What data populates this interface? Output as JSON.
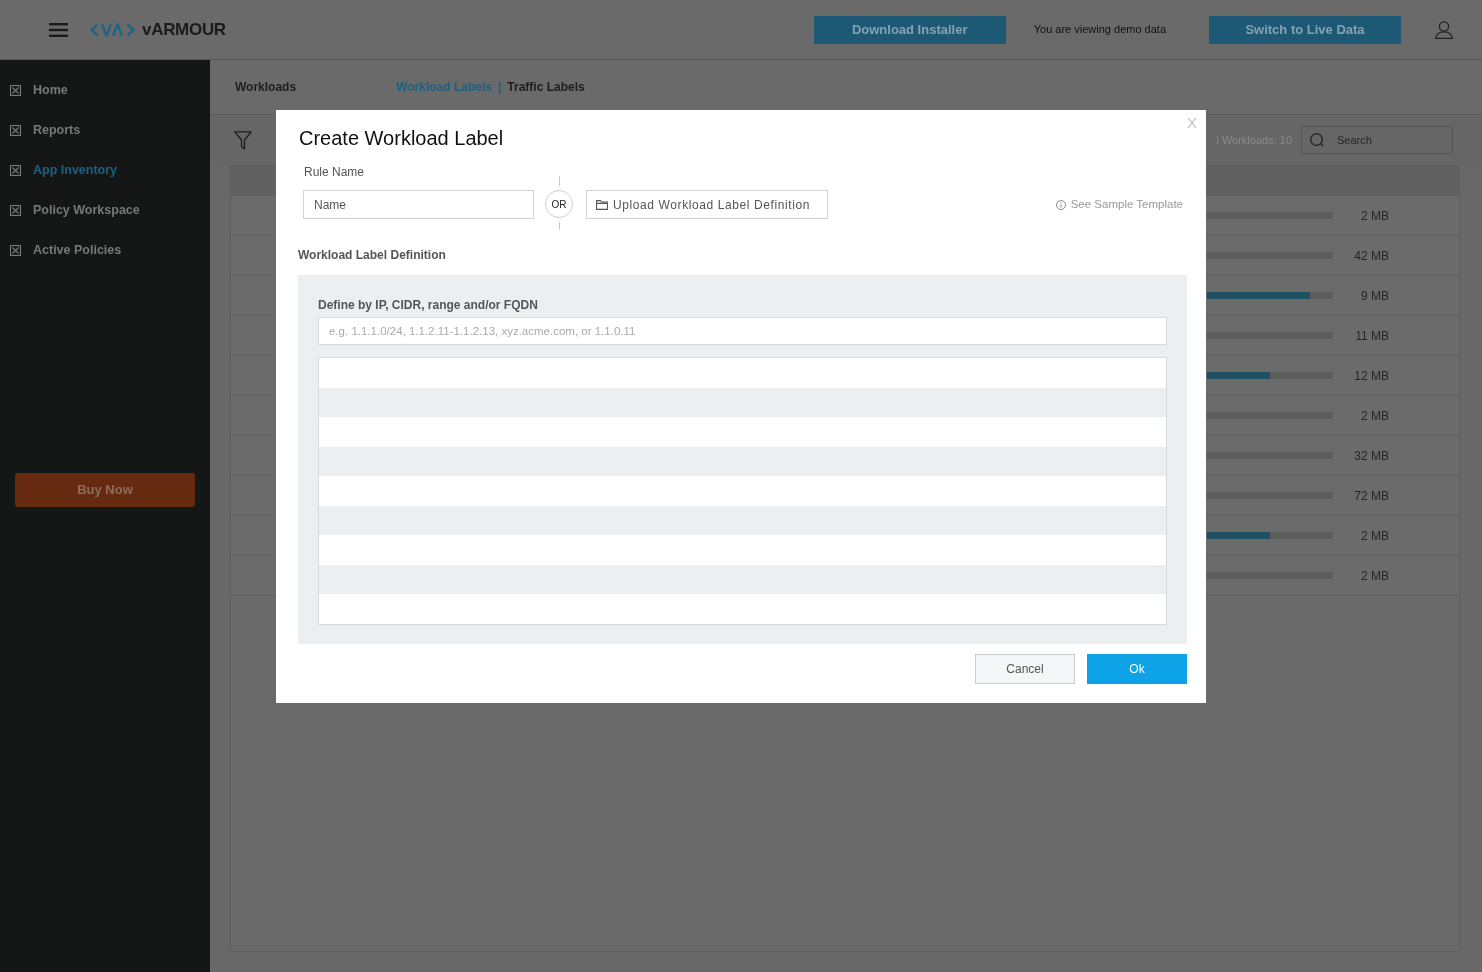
{
  "top_bar": {
    "logo_text": "vARMOUR",
    "download_button": "Download Installer",
    "demo_notice": "You are viewing demo data",
    "live_button": "Switch to Live Data"
  },
  "sidebar": {
    "items": [
      {
        "label": "Home",
        "selected": false
      },
      {
        "label": "Reports",
        "selected": false
      },
      {
        "label": "App Inventory",
        "selected": true
      },
      {
        "label": "Policy Workspace",
        "selected": false
      },
      {
        "label": "Active Policies",
        "selected": false
      }
    ],
    "buy_button": "Buy Now"
  },
  "page": {
    "title": "Workloads",
    "tabs": [
      {
        "label": "Workload Labels",
        "selected": true
      },
      {
        "label": "Traffic Labels",
        "selected": false
      }
    ],
    "tab_separator": "|",
    "workload_count": "l Workloads: 10",
    "search": {
      "placeholder": "Search"
    },
    "table": {
      "rows": [
        {
          "reading": "2 MB"
        },
        {
          "reading": "42 MB"
        },
        {
          "level": 0.82,
          "reading": "9 MB"
        },
        {
          "reading": "11 MB"
        },
        {
          "level": 0.5,
          "reading": "12 MB"
        },
        {
          "reading": "2 MB"
        },
        {
          "reading": "32 MB"
        },
        {
          "reading": "72 MB"
        },
        {
          "level": 0.5,
          "reading": "2 MB"
        },
        {
          "reading": "2 MB"
        }
      ]
    }
  },
  "modal": {
    "title": "Create Workload Label",
    "close": "X",
    "rule_name_label": "Rule Name",
    "name_input": {
      "placeholder": "Name"
    },
    "or_label": "OR",
    "upload_button": "Upload Workload Label Definition",
    "sample_link": "See Sample Template",
    "definition_heading": "Workload Label Definition",
    "define_label": "Define by IP, CIDR, range and/or FQDN",
    "define_input": {
      "placeholder": "e.g. 1.1.1.0/24, 1.1.2.11-1.1.2.13, xyz.acme.com, or 1.1.0.11"
    },
    "buttons": [
      {
        "label": "Cancel",
        "kind": "secondary"
      },
      {
        "label": "Ok",
        "kind": "primary"
      }
    ]
  }
}
